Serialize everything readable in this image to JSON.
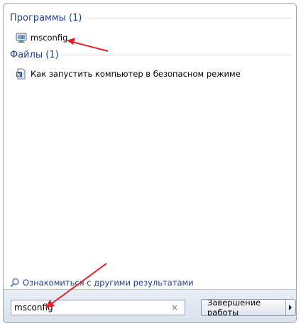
{
  "results": {
    "programs_header": "Программы (1)",
    "programs": [
      {
        "label": "msconfig",
        "icon": "msconfig-icon"
      }
    ],
    "files_header": "Файлы (1)",
    "files": [
      {
        "label": "Как запустить компьютер в безопасном режиме",
        "icon": "word-document-icon"
      }
    ],
    "see_more": "Ознакомиться с другими результатами"
  },
  "search": {
    "value": "msconfig",
    "clear_glyph": "×"
  },
  "shutdown": {
    "label": "Завершение работы"
  },
  "colors": {
    "header_text": "#1e3f8a",
    "annotation_arrow": "#e0202a"
  }
}
